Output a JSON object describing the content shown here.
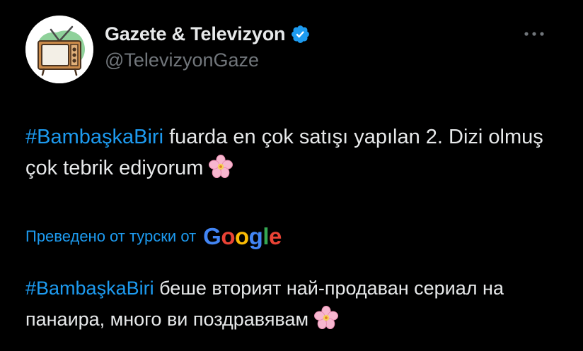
{
  "author": {
    "display_name": "Gazete & Televizyon",
    "handle": "@TelevizyonGaze",
    "verified_icon": "verified-badge-icon",
    "avatar_icon": "retro-tv-icon"
  },
  "more_icon": "more-options-icon",
  "tweet": {
    "hashtag": "#BambaşkaBiri",
    "text_after_hashtag": " fuarda en çok satışı  yapılan 2. Dizi olmuş çok tebrik ediyorum",
    "emoji": "cherry-blossom-icon"
  },
  "translation": {
    "label": "Преведено от турски от",
    "provider": "Google",
    "hashtag": "#BambaşkaBiri",
    "text_after_hashtag": " беше вторият най-продаван сериал на панаира, много ви поздравявам",
    "emoji": "cherry-blossom-icon"
  },
  "colors": {
    "background": "#000000",
    "text": "#e7e9ea",
    "secondary_text": "#71767b",
    "accent": "#1d9bf0",
    "google_blue": "#4285f4",
    "google_red": "#ea4335",
    "google_yellow": "#fbbc05",
    "google_green": "#34a853"
  }
}
